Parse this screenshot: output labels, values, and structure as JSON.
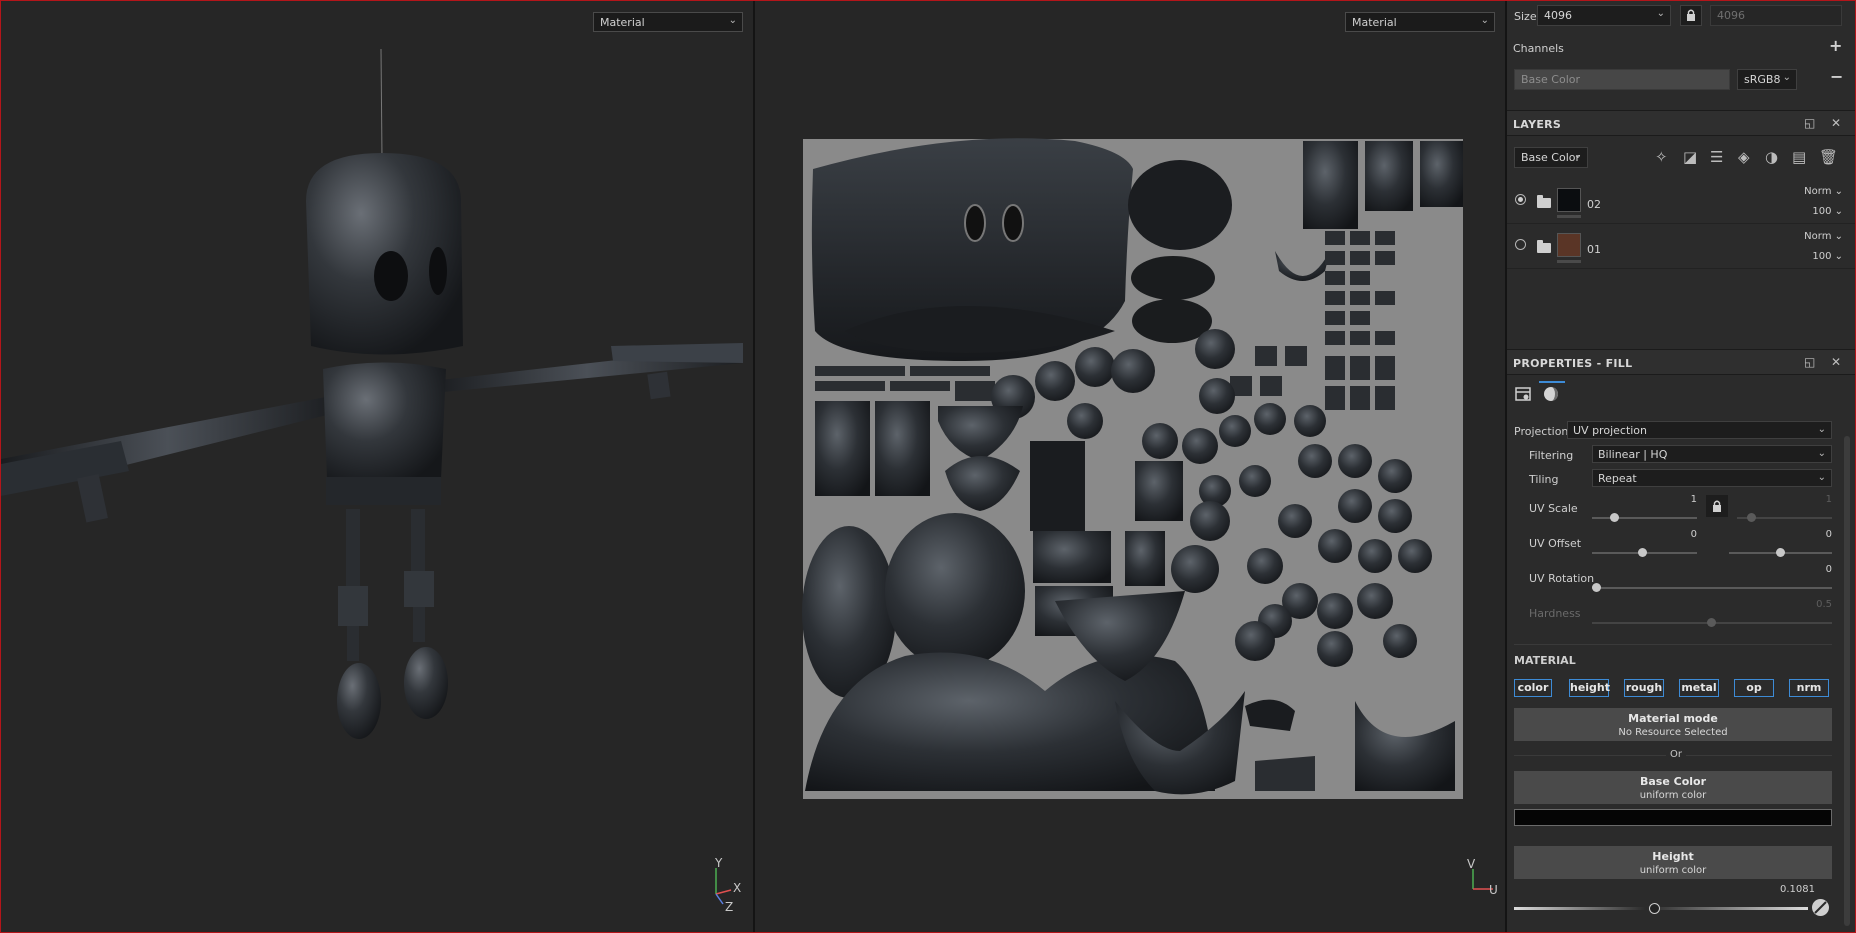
{
  "viewports": {
    "left_mode": "Material",
    "right_mode": "Material",
    "axes_3d": {
      "y": "Y",
      "x": "X",
      "z": "Z"
    },
    "axes_2d": {
      "v": "V",
      "u": "U"
    }
  },
  "texture_set": {
    "size_label": "Size",
    "size_value": "4096",
    "size_linked_value": "4096",
    "channels_label": "Channels",
    "channel_name": "Base Color",
    "channel_format": "sRGB8"
  },
  "layers": {
    "title": "LAYERS",
    "channel_select": "Base Color",
    "items": [
      {
        "name": "02",
        "blend": "Norm",
        "opacity": "100",
        "visible": true,
        "thumb": "#0b0d10"
      },
      {
        "name": "01",
        "blend": "Norm",
        "opacity": "100",
        "visible": false,
        "thumb": "#5a3526"
      }
    ]
  },
  "properties": {
    "title": "PROPERTIES - FILL",
    "projection_label": "Projection",
    "projection_value": "UV projection",
    "filtering_label": "Filtering",
    "filtering_value": "Bilinear | HQ",
    "tiling_label": "Tiling",
    "tiling_value": "Repeat",
    "uv_scale_label": "UV Scale",
    "uv_scale_value": "1",
    "uv_scale_value2": "1",
    "uv_offset_label": "UV Offset",
    "uv_offset_u": "0",
    "uv_offset_v": "0",
    "uv_rotation_label": "UV Rotation",
    "uv_rotation_value": "0",
    "hardness_label": "Hardness",
    "hardness_value": "0.5"
  },
  "material": {
    "title": "MATERIAL",
    "channel_buttons": [
      "color",
      "height",
      "rough",
      "metal",
      "op",
      "nrm"
    ],
    "mode_title": "Material mode",
    "mode_subtitle": "No Resource Selected",
    "or_label": "Or",
    "base_color_title": "Base Color",
    "base_color_subtitle": "uniform color",
    "base_color_swatch": "#050505",
    "height_title": "Height",
    "height_subtitle": "uniform color",
    "height_value": "0.1081"
  },
  "colors": {
    "accent": "#3d8bd6",
    "frame": "#b4151a",
    "uv_background": "#8a8a8a"
  }
}
